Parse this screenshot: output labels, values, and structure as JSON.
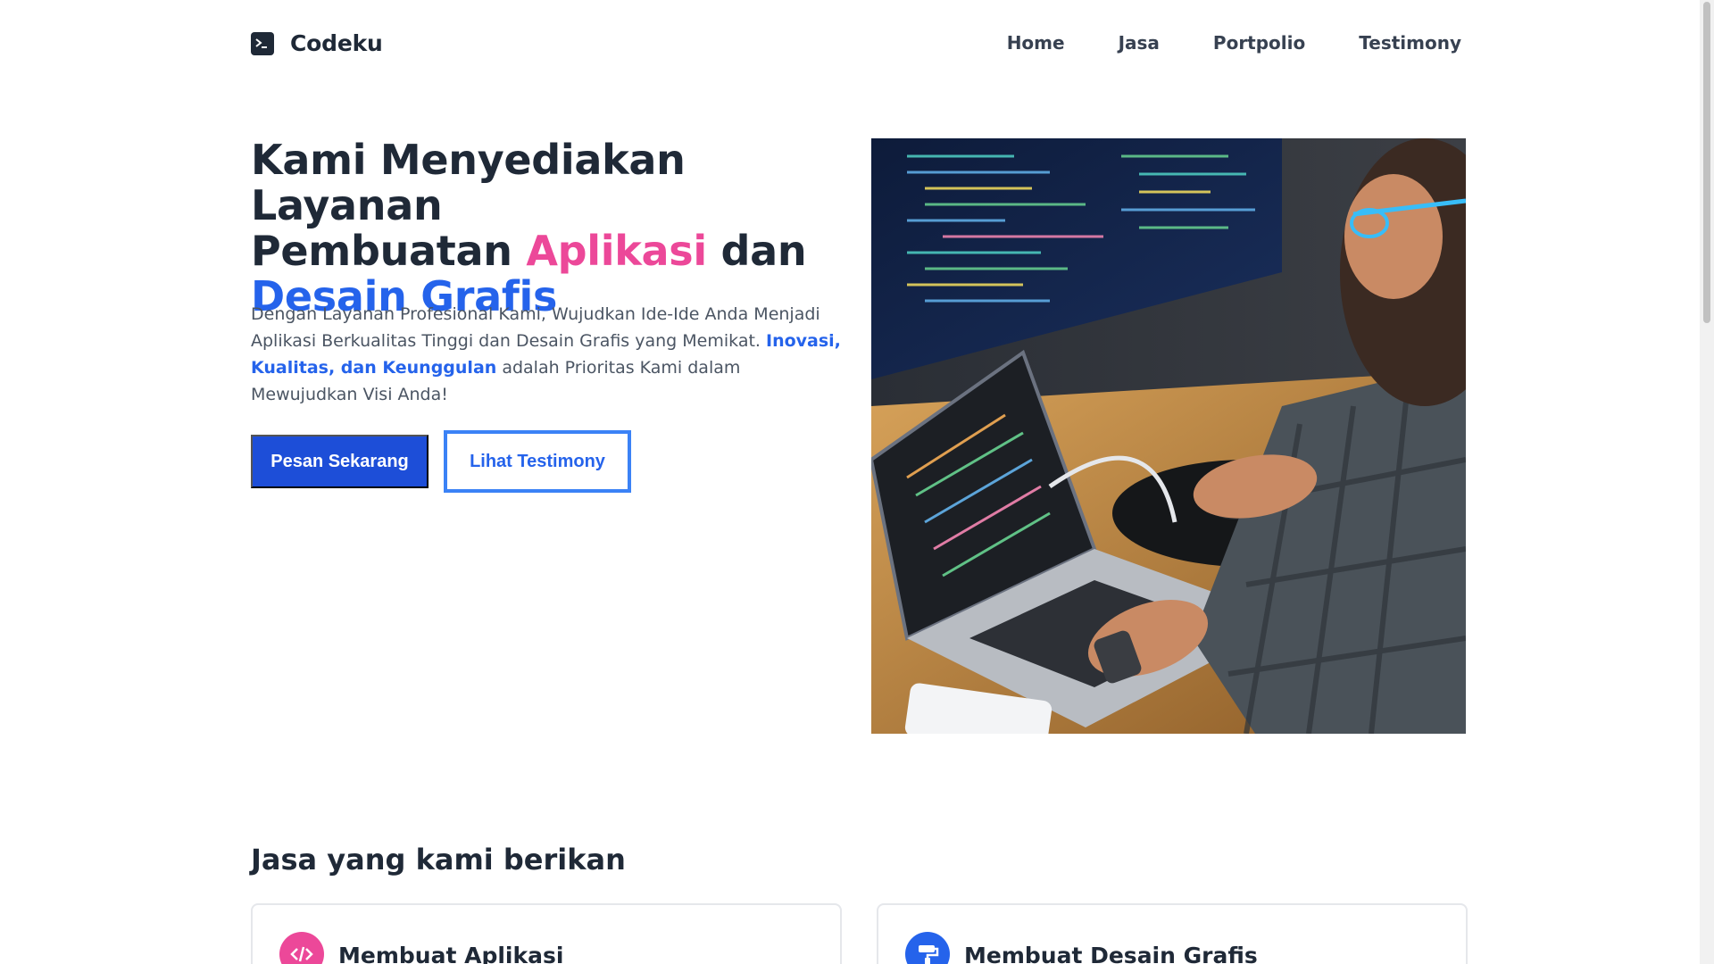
{
  "brand": {
    "name": "Codeku",
    "icon": "terminal-icon"
  },
  "nav": {
    "items": [
      "Home",
      "Jasa",
      "Portpolio",
      "Testimony"
    ]
  },
  "hero": {
    "title_line1": "Kami Menyediakan Layanan",
    "title_part2": "Pembuatan ",
    "title_highlight1": "Aplikasi",
    "title_part3": " dan",
    "title_highlight2": "Desain Grafis",
    "desc_part1": "Dengan Layanan Profesional Kami, Wujudkan Ide-Ide Anda Menjadi Aplikasi Berkualitas Tinggi dan Desain Grafis yang Memikat. ",
    "desc_emphasis": "Inovasi, Kualitas, dan Keunggulan",
    "desc_part2": " adalah Prioritas Kami dalam Mewujudkan Visi Anda!",
    "btn_primary": "Pesan Sekarang",
    "btn_secondary": "Lihat Testimony"
  },
  "services": {
    "title": "Jasa yang kami berikan",
    "cards": [
      {
        "title": "Membuat Aplikasi",
        "icon": "code-icon"
      },
      {
        "title": "Membuat Desain Grafis",
        "icon": "paint-roller-icon"
      }
    ]
  },
  "colors": {
    "accent_blue": "#2563eb",
    "accent_pink": "#ec4899",
    "text_dark": "#1f2937"
  }
}
